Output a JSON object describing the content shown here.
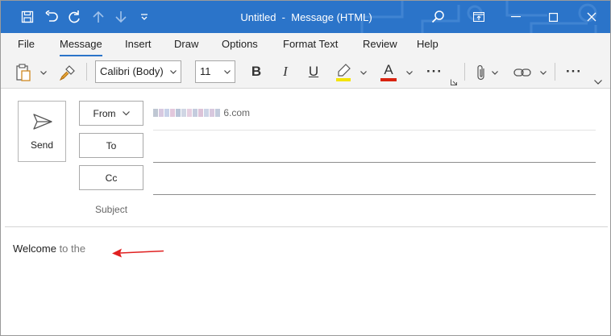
{
  "titlebar": {
    "title": "Untitled",
    "separator": "-",
    "subtitle": "Message (HTML)",
    "accent": "#2b74c9"
  },
  "quick_access": [
    "save-icon",
    "undo-icon",
    "redo-icon",
    "up-arrow-icon",
    "down-arrow-icon",
    "customize-icon"
  ],
  "menu": {
    "tabs": [
      "File",
      "Message",
      "Insert",
      "Draw",
      "Options",
      "Format Text",
      "Review",
      "Help"
    ],
    "active": "Message"
  },
  "ribbon": {
    "font_name": "Calibri (Body)",
    "font_size": "11",
    "bold": "B",
    "italic": "I",
    "underline": "U",
    "font_color_glyph": "A",
    "more": "···",
    "more2": "···",
    "highlight_color": "#f4e400",
    "font_color": "#d9230f"
  },
  "compose": {
    "send_label": "Send",
    "from_label": "From",
    "to_label": "To",
    "cc_label": "Cc",
    "subject_label": "Subject",
    "from_value_prefix": "",
    "from_value_suffix": "6.com"
  },
  "body": {
    "word1": "Welcome",
    "word2": " to the",
    "arrow_color": "#e02020"
  }
}
